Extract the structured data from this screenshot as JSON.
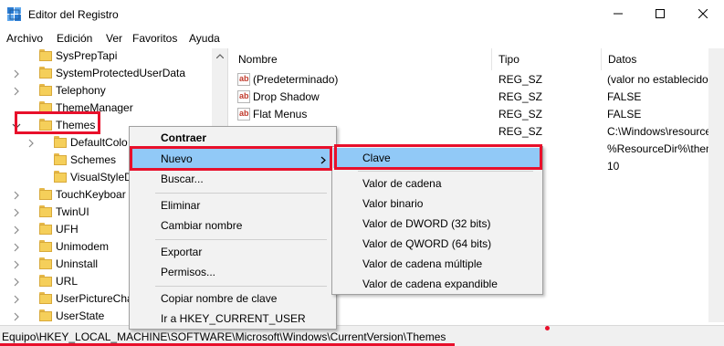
{
  "window": {
    "title": "Editor del Registro",
    "icon": "registry-editor-icon",
    "controls": [
      "minimize-icon",
      "maximize-icon",
      "close-icon"
    ]
  },
  "menubar": {
    "items": [
      "Archivo",
      "Edición",
      "Ver",
      "Favoritos",
      "Ayuda"
    ]
  },
  "tree": {
    "items": [
      {
        "label": "SysPrepTapi",
        "expander": "none"
      },
      {
        "label": "SystemProtectedUserData",
        "expander": "collapsed"
      },
      {
        "label": "Telephony",
        "expander": "collapsed"
      },
      {
        "label": "ThemeManager",
        "expander": "none"
      },
      {
        "label": "Themes",
        "expander": "expanded",
        "selected": true
      },
      {
        "label": "DefaultColo",
        "expander": "collapsed"
      },
      {
        "label": "Schemes",
        "expander": "none"
      },
      {
        "label": "VisualStyleD",
        "expander": "none"
      },
      {
        "label": "TouchKeyboar",
        "expander": "collapsed"
      },
      {
        "label": "TwinUI",
        "expander": "collapsed"
      },
      {
        "label": "UFH",
        "expander": "collapsed"
      },
      {
        "label": "Unimodem",
        "expander": "collapsed"
      },
      {
        "label": "Uninstall",
        "expander": "collapsed"
      },
      {
        "label": "URL",
        "expander": "collapsed"
      },
      {
        "label": "UserPictureCha",
        "expander": "collapsed"
      },
      {
        "label": "UserState",
        "expander": "collapsed"
      }
    ]
  },
  "list": {
    "headers": {
      "name": "Nombre",
      "type": "Tipo",
      "data": "Datos"
    },
    "rows": [
      {
        "name": "(Predeterminado)",
        "type": "REG_SZ",
        "data": "(valor no establecido)"
      },
      {
        "name": "Drop Shadow",
        "type": "REG_SZ",
        "data": "FALSE"
      },
      {
        "name": "Flat Menus",
        "type": "REG_SZ",
        "data": "FALSE"
      },
      {
        "name": "",
        "type": "REG_SZ",
        "data": "C:\\Windows\\resources\\"
      },
      {
        "name": "",
        "type": "",
        "data": "%ResourceDir%\\themes"
      },
      {
        "name": "",
        "type": "",
        "data": "10"
      }
    ]
  },
  "context_menu": {
    "items": [
      {
        "label": "Contraer",
        "bold": true
      },
      {
        "label": "Nuevo",
        "submenu": true,
        "highlighted": true
      },
      {
        "label": "Buscar..."
      },
      {
        "separator": true
      },
      {
        "label": "Eliminar"
      },
      {
        "label": "Cambiar nombre"
      },
      {
        "separator": true
      },
      {
        "label": "Exportar"
      },
      {
        "label": "Permisos..."
      },
      {
        "separator": true
      },
      {
        "label": "Copiar nombre de clave"
      },
      {
        "label": "Ir a HKEY_CURRENT_USER"
      }
    ],
    "submenu_items": [
      {
        "label": "Clave",
        "highlighted": true
      },
      {
        "separator": true
      },
      {
        "label": "Valor de cadena"
      },
      {
        "label": "Valor binario"
      },
      {
        "label": "Valor de DWORD (32 bits)"
      },
      {
        "label": "Valor de QWORD (64 bits)"
      },
      {
        "label": "Valor de cadena múltiple"
      },
      {
        "label": "Valor de cadena expandible"
      }
    ]
  },
  "statusbar": {
    "path": "Equipo\\HKEY_LOCAL_MACHINE\\SOFTWARE\\Microsoft\\Windows\\CurrentVersion\\Themes"
  },
  "colors": {
    "annotation_red": "#e8102b",
    "menu_highlight": "#91c9f7",
    "folder_yellow": "#f5cf5a"
  }
}
